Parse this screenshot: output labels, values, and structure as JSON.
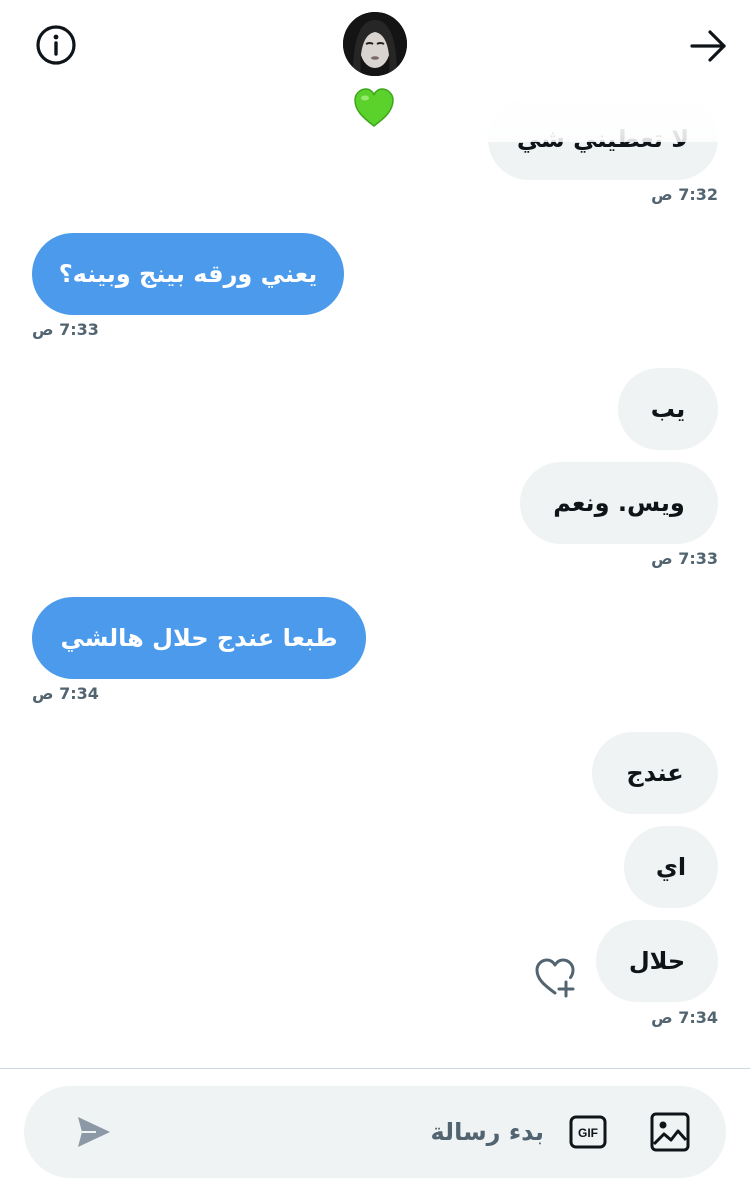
{
  "header": {
    "status_emoji": "green-heart"
  },
  "messages": {
    "m0": {
      "text": "لا تعطيني شي",
      "time": "7:32 ص"
    },
    "m1": {
      "text": "يعني ورقه بينج وبينه؟",
      "time": "7:33 ص"
    },
    "m2": {
      "text": "يب"
    },
    "m3": {
      "text": "ويس. ونعم",
      "time": "7:33 ص"
    },
    "m4": {
      "text": "طبعا عندج حلال هالشي",
      "time": "7:34 ص"
    },
    "m5": {
      "text": "عندج"
    },
    "m6": {
      "text": "اي"
    },
    "m7": {
      "text": "حلال",
      "time": "7:34 ص"
    }
  },
  "composer": {
    "placeholder": "بدء رسالة",
    "value": ""
  },
  "colors": {
    "outgoing_bubble": "#4c9aeb",
    "incoming_bubble": "#eff3f4",
    "timestamp": "#536471"
  },
  "icons": [
    "info-icon",
    "back-arrow-icon",
    "heart-plus-icon",
    "send-icon",
    "gif-icon",
    "image-icon"
  ]
}
